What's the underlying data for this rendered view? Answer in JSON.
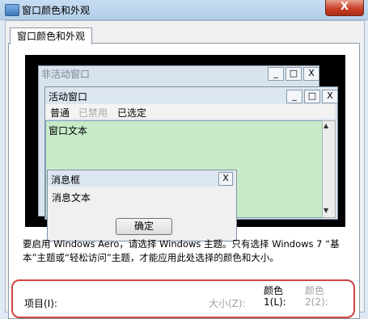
{
  "window": {
    "title": "窗口颜色和外观",
    "close_symbol": "X"
  },
  "tab": {
    "label": "窗口颜色和外观"
  },
  "preview": {
    "inactive_window_title": "非活动窗口",
    "active_window_title": "活动窗口",
    "controls": {
      "minimize": "_",
      "maximize": "□",
      "close": "X"
    },
    "menu": [
      "普通",
      "已禁用",
      "已选定"
    ],
    "window_text": "窗口文本",
    "scroll_up": "▲",
    "scroll_down": "▼",
    "message_box": {
      "title": "消息框",
      "close": "X",
      "text": "消息文本",
      "ok": "确定"
    }
  },
  "note": "要启用 Windows Aero，请选择 Windows 主题。只有选择 Windows 7 “基本”主题或“轻松访问”主题，才能应用此处选择的颜色和大小。",
  "settings": {
    "item_label": "项目(I):",
    "size_label": "大小(Z):",
    "color1_head": "颜色",
    "color1_label": "1(L):",
    "color2_head": "颜色",
    "color2_label": "2(2):"
  },
  "colors": {
    "preview_window_text_bg": "#c7ebc9",
    "highlight_frame": "#d04343"
  }
}
